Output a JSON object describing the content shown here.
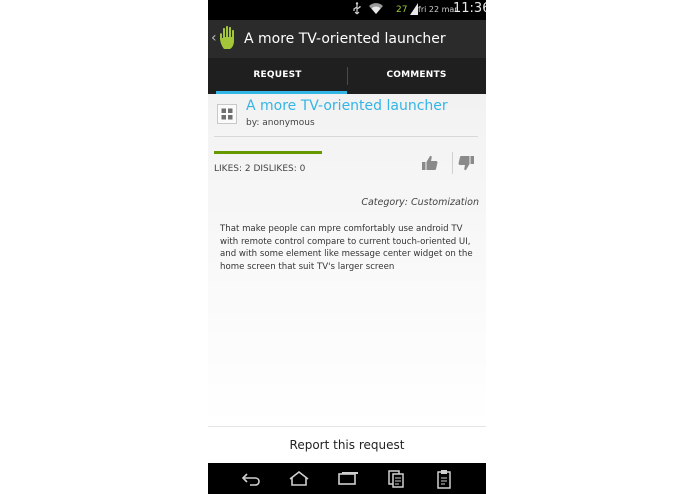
{
  "status_bar": {
    "battery_level": "27",
    "date": "fri 22 mar",
    "time": "11:36",
    "icons": [
      "usb-icon",
      "wifi-icon",
      "battery-icon",
      "signal-icon"
    ]
  },
  "action_bar": {
    "title": "A more TV-oriented launcher",
    "icons": [
      "back-chevron-icon",
      "hand-logo-icon"
    ]
  },
  "tabs": [
    {
      "label": "REQUEST",
      "selected": true
    },
    {
      "label": "COMMENTS",
      "selected": false
    }
  ],
  "request": {
    "title": "A more TV-oriented launcher",
    "author": "by: anonymous",
    "likes_summary": "LIKES: 2 DISLIKES: 0",
    "like_ratio": 1.0,
    "category": "Category: Customization",
    "description": "That make people can mpre comfortably use android TV with remote control compare to current touch-oriented UI, and with some element like message center widget on the home screen that suit TV's larger screen"
  },
  "report": {
    "label": "Report this request"
  },
  "nav_bar": {
    "icons": [
      "back-icon",
      "home-icon",
      "recents-icon",
      "copy-icon",
      "clipboard-icon"
    ]
  },
  "colors": {
    "accent": "#33b5e5",
    "progress": "#669900",
    "battery": "#9acd32"
  }
}
